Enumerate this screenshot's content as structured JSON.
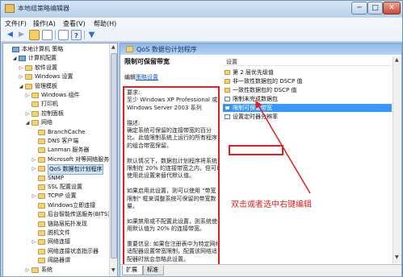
{
  "window": {
    "title": "本地组策略编辑器",
    "buttons": {
      "min": "─",
      "max": "□",
      "close": "✕"
    }
  },
  "menu": [
    "文件(F)",
    "操作(A)",
    "查看(V)",
    "帮助(H)"
  ],
  "toolbar": [
    "back-arrow-icon",
    "forward-arrow-icon",
    "folder-icon",
    "list-view-icon",
    "export-icon",
    "help-icon",
    "filter-icon"
  ],
  "tree": {
    "rows": [
      {
        "label": "本地计算机 策略",
        "toggle": "",
        "icon": "computer",
        "indent": 0
      },
      {
        "label": "计算机配置",
        "toggle": "◢",
        "icon": "computer",
        "indent": 1
      },
      {
        "label": "软件设置",
        "toggle": "▷",
        "icon": "folder",
        "indent": 2
      },
      {
        "label": "Windows 设置",
        "toggle": "▷",
        "icon": "folder",
        "indent": 2
      },
      {
        "label": "管理模板",
        "toggle": "◢",
        "icon": "folder",
        "indent": 2
      },
      {
        "label": "Windows 组件",
        "toggle": "▷",
        "icon": "folder",
        "indent": 3
      },
      {
        "label": "打印机",
        "toggle": "",
        "icon": "folder",
        "indent": 3
      },
      {
        "label": "控制面板",
        "toggle": "▷",
        "icon": "folder",
        "indent": 3
      },
      {
        "label": "网络",
        "toggle": "◢",
        "icon": "folder",
        "indent": 3
      },
      {
        "label": "BranchCache",
        "toggle": "",
        "icon": "folder",
        "indent": 4
      },
      {
        "label": "DNS 客户端",
        "toggle": "",
        "icon": "folder",
        "indent": 4
      },
      {
        "label": "Lanman 服务器",
        "toggle": "",
        "icon": "folder",
        "indent": 4
      },
      {
        "label": "Microsoft 对等网络服务",
        "toggle": "▷",
        "icon": "folder",
        "indent": 4
      },
      {
        "label": "QoS 数据包计划程序",
        "toggle": "▷",
        "icon": "folder",
        "indent": 4,
        "selected": true
      },
      {
        "label": "SNMP",
        "toggle": "",
        "icon": "folder",
        "indent": 4
      },
      {
        "label": "SSL 配置设置",
        "toggle": "",
        "icon": "folder",
        "indent": 4
      },
      {
        "label": "TCPIP 设置",
        "toggle": "▷",
        "icon": "folder",
        "indent": 4
      },
      {
        "label": "Windows立即连接",
        "toggle": "",
        "icon": "folder",
        "indent": 4
      },
      {
        "label": "后台智能传送服务(BITS)",
        "toggle": "",
        "icon": "folder",
        "indent": 4
      },
      {
        "label": "链路层拓扑发现",
        "toggle": "",
        "icon": "folder",
        "indent": 4
      },
      {
        "label": "脱机文件",
        "toggle": "",
        "icon": "folder",
        "indent": 4
      },
      {
        "label": "网络连接",
        "toggle": "▷",
        "icon": "folder",
        "indent": 4
      },
      {
        "label": "网络连接状态指示器",
        "toggle": "",
        "icon": "folder",
        "indent": 4
      },
      {
        "label": "阈路器谓",
        "toggle": "",
        "icon": "folder",
        "indent": 4
      },
      {
        "label": "系统",
        "toggle": "▷",
        "icon": "folder",
        "indent": 3
      }
    ]
  },
  "detail": {
    "header": "QoS 数据包计划程序",
    "title": "限制可保留带宽",
    "edit_prefix": "编辑",
    "edit_link": "策略设置",
    "description_lines": [
      "要求:",
      "至少 Windows XP Professional 或",
      "Windows Server 2003 系列",
      "",
      "描述:",
      "确定系统可保留的连接带宽的百分",
      "比。此值限制系统上运行的所有程序",
      "的组合带宽保留。",
      "",
      "默认情况下，数据包计划程序将系统",
      "限制在 20% 的连接带宽之内，但可以",
      "使用此设置来替代默认值。",
      "",
      "如果启用此设置，则可以使用 \"带宽",
      "限制\" 框来调整系统可保留的带宽数",
      "量。",
      "",
      "如果禁用或不配置此设置，则系统使",
      "用默认值为 20% 的连接带宽。",
      "",
      "重要信息: 如果在注册表中为特定网络",
      "适配器设置带宽限制，配置该网络适",
      "配器时就会忽略此设置。"
    ],
    "list_header": "设置",
    "items": [
      {
        "label": "第 2 层优先级值",
        "icon": "folder"
      },
      {
        "label": "非一致性数据包的 DSCP 值",
        "icon": "folder"
      },
      {
        "label": "一致性数据包的 DSCP 值",
        "icon": "folder"
      },
      {
        "label": "限制未完成数据包",
        "icon": "policy"
      },
      {
        "label": "限制可保留带宽",
        "icon": "policy",
        "selected": true
      },
      {
        "label": "设置定时器分辨率",
        "icon": "policy"
      }
    ],
    "annotation": "双击或者选中右键编辑",
    "tabs": [
      "扩展",
      "标准"
    ]
  },
  "colors": {
    "accent_red": "#e02020",
    "selection_blue": "#3399ff",
    "header_blue": "#8fb7e8"
  }
}
